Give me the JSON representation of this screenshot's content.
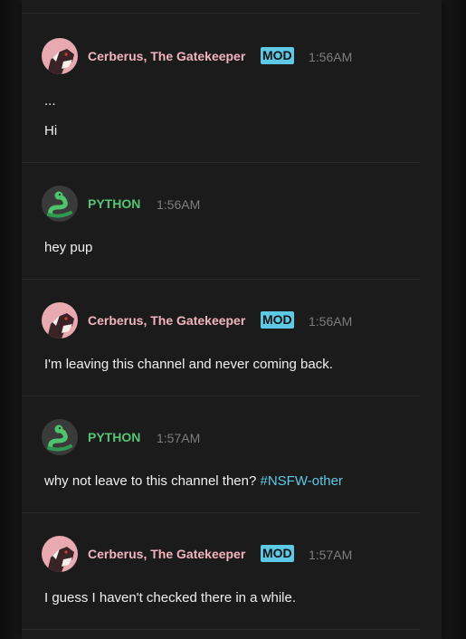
{
  "colors": {
    "mod_name": "#f3b5bd",
    "python_name": "#55c473",
    "mod_badge": "#5ec9e6",
    "link": "#5ec9e6",
    "timestamp": "#7d7d7d",
    "background": "#1b1b1b"
  },
  "messages": [
    {
      "author": "Cerberus, The Gatekeeper",
      "badge": "MOD",
      "time": "1:56AM",
      "avatar_icon": "cerberus-avatar-icon",
      "lines": [
        "...",
        "Hi"
      ]
    },
    {
      "author": "PYTHON",
      "time": "1:56AM",
      "avatar_icon": "python-snake-avatar-icon",
      "lines": [
        "hey pup"
      ]
    },
    {
      "author": "Cerberus, The Gatekeeper",
      "badge": "MOD",
      "time": "1:56AM",
      "avatar_icon": "cerberus-avatar-icon",
      "lines": [
        "I'm leaving this channel and never coming back."
      ]
    },
    {
      "author": "PYTHON",
      "time": "1:57AM",
      "avatar_icon": "python-snake-avatar-icon",
      "text_before_link": "why not leave to this channel then? ",
      "channel_link": "#NSFW-other"
    },
    {
      "author": "Cerberus, The Gatekeeper",
      "badge": "MOD",
      "time": "1:57AM",
      "avatar_icon": "cerberus-avatar-icon",
      "lines": [
        "I guess I haven't checked there in a while."
      ]
    }
  ]
}
